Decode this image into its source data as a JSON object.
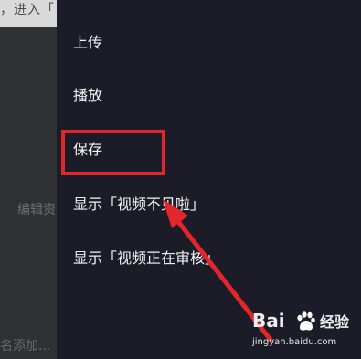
{
  "background_app": {
    "top_text": "，进入「",
    "edit_text": "编辑资",
    "bottom_text": "名添加..."
  },
  "menu": {
    "items": [
      {
        "label": "上传"
      },
      {
        "label": "播放"
      },
      {
        "label": "保存"
      },
      {
        "label": "显示「视频不见啦」"
      },
      {
        "label": "显示「视频正在审核」"
      }
    ],
    "highlighted_index": 2
  },
  "annotation": {
    "highlight_color": "#e3262b",
    "arrow_color": "#e3262b"
  },
  "watermark": {
    "brand_prefix": "Bai",
    "brand_suffix": "经验",
    "url": "jingyan.baidu.com"
  },
  "colors": {
    "menu_background": "#1c1c28",
    "menu_text": "#f2f2f2",
    "dim_background": "#303134"
  }
}
